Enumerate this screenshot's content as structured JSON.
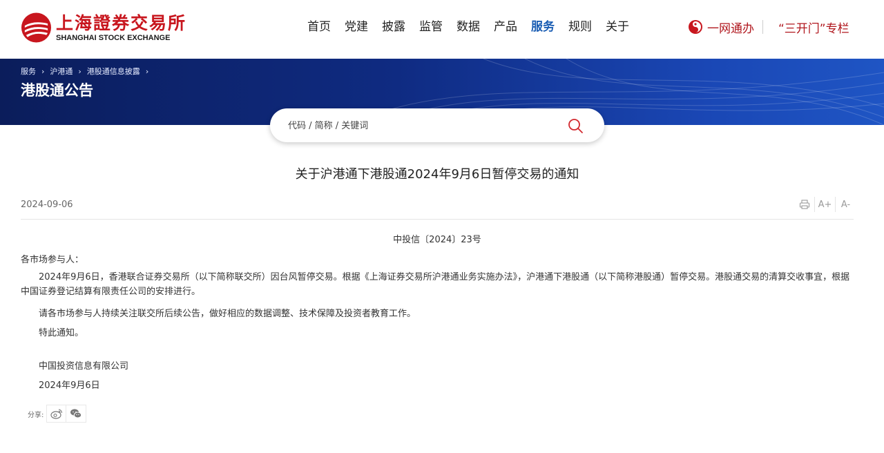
{
  "header": {
    "logo": {
      "name_cn": "上海證券交易所",
      "name_en": "SHANGHAI STOCK EXCHANGE",
      "brand_color": "#c8161e"
    },
    "nav": [
      {
        "label": "首页",
        "active": false
      },
      {
        "label": "党建",
        "active": false
      },
      {
        "label": "披露",
        "active": false
      },
      {
        "label": "监管",
        "active": false
      },
      {
        "label": "数据",
        "active": false
      },
      {
        "label": "产品",
        "active": false
      },
      {
        "label": "服务",
        "active": true
      },
      {
        "label": "规则",
        "active": false
      },
      {
        "label": "关于",
        "active": false
      }
    ],
    "active_color": "#1a5db3",
    "quick_links": {
      "one_network": "一网通办",
      "three_open": "“三开门”专栏",
      "color": "#b0161d"
    }
  },
  "banner": {
    "breadcrumb": [
      "服务",
      "沪港通",
      "港股通信息披露"
    ],
    "title": "港股通公告"
  },
  "search": {
    "placeholder": "代码 / 简称 / 关键词",
    "value": ""
  },
  "article": {
    "title": "关于沪港通下港股通2024年9月6日暂停交易的通知",
    "date": "2024-09-06",
    "tools": {
      "print_icon": "printer-icon",
      "font_larger": "A+",
      "font_smaller": "A-"
    },
    "doc_number": "中投信〔2024〕23号",
    "salutation": "各市场参与人：",
    "paragraphs": [
      "2024年9月6日，香港联合证券交易所（以下简称联交所）因台风暂停交易。根据《上海证券交易所沪港通业务实施办法》，沪港通下港股通（以下简称港股通）暂停交易。港股通交易的清算交收事宜，根据中国证券登记结算有限责任公司的安排进行。",
      "请各市场参与人持续关注联交所后续公告，做好相应的数据调整、技术保障及投资者教育工作。",
      "特此通知。"
    ],
    "signature": "中国投资信息有限公司",
    "sign_date": "2024年9月6日"
  },
  "share": {
    "label": "分享:",
    "icons": [
      "weibo-icon",
      "wechat-icon"
    ]
  }
}
